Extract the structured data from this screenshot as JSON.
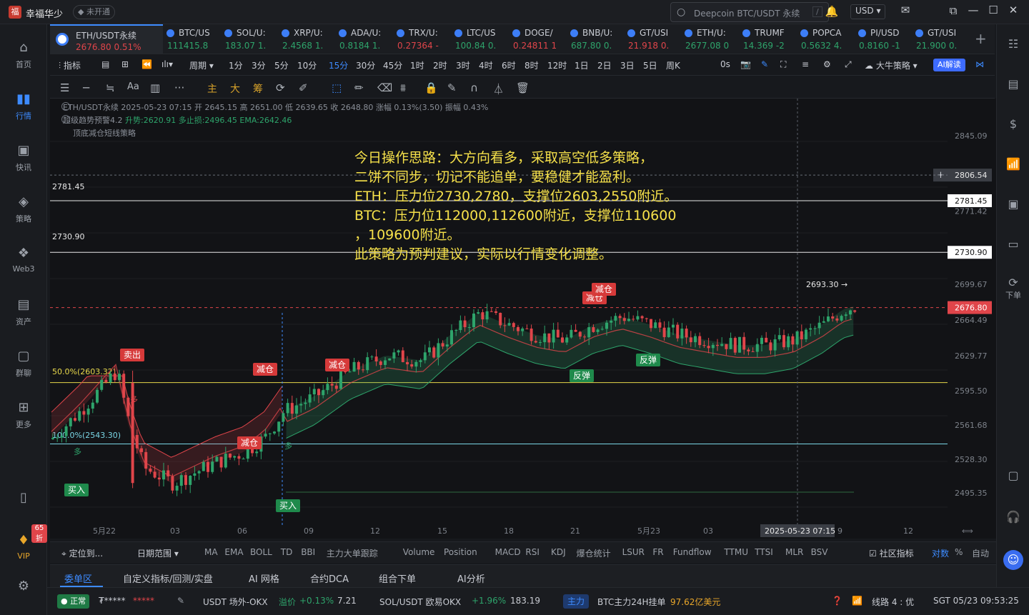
{
  "app": {
    "name": "幸福华少",
    "vip_status": "未开通"
  },
  "search": {
    "placeholder": "Deepcoin BTC/USDT 永续",
    "shortcut": "/"
  },
  "currency": "USD",
  "sidebar": [
    {
      "label": "首页",
      "icon": "home-icon"
    },
    {
      "label": "行情",
      "icon": "chart-bars-icon",
      "active": true
    },
    {
      "label": "快讯",
      "icon": "news-icon"
    },
    {
      "label": "策略",
      "icon": "strategy-icon"
    },
    {
      "label": "Web3",
      "icon": "web3-icon"
    },
    {
      "label": "资产",
      "icon": "wallet-icon"
    },
    {
      "label": "群聊",
      "icon": "chat-icon"
    },
    {
      "label": "更多",
      "icon": "grid-icon"
    }
  ],
  "vip_badge": "65折",
  "vip_label": "VIP",
  "tickers": [
    {
      "name": "ETH/USDT永续",
      "price": "2676.80",
      "change": "0.51%",
      "dir": "dn"
    },
    {
      "name": "BTC/US",
      "price": "111415.8",
      "change": "",
      "dir": "up"
    },
    {
      "name": "SOL/U:",
      "price": "183.07",
      "change": "1.",
      "dir": "up"
    },
    {
      "name": "XRP/U:",
      "price": "2.4568",
      "change": "1.",
      "dir": "up"
    },
    {
      "name": "ADA/U:",
      "price": "0.8184",
      "change": "1.",
      "dir": "up"
    },
    {
      "name": "TRX/U:",
      "price": "0.27364",
      "change": "-",
      "dir": "dn"
    },
    {
      "name": "LTC/US",
      "price": "100.84",
      "change": "0.",
      "dir": "up"
    },
    {
      "name": "DOGE/",
      "price": "0.24811",
      "change": "1",
      "dir": "dn"
    },
    {
      "name": "BNB/U:",
      "price": "687.80",
      "change": "0.",
      "dir": "up"
    },
    {
      "name": "GT/USI",
      "price": "21.918",
      "change": "0.",
      "dir": "dn"
    },
    {
      "name": "ETH/U:",
      "price": "2677.08",
      "change": "0",
      "dir": "up"
    },
    {
      "name": "TRUMF",
      "price": "14.369",
      "change": "-2",
      "dir": "up"
    },
    {
      "name": "POPCA",
      "price": "0.5632",
      "change": "4.",
      "dir": "up"
    },
    {
      "name": "PI/USD",
      "price": "0.8160",
      "change": "-1",
      "dir": "up"
    },
    {
      "name": "GT/USI",
      "price": "21.900",
      "change": "0.",
      "dir": "up"
    }
  ],
  "toolbar": {
    "indicator": "指标",
    "period_label": "周期",
    "periods": [
      "1分",
      "3分",
      "5分",
      "10分",
      "15分",
      "30分",
      "45分",
      "1时",
      "2时",
      "3时",
      "4时",
      "6时",
      "8时",
      "12时",
      "1日",
      "2日",
      "3日",
      "5日",
      "周K"
    ],
    "selected_period": "15分",
    "countdown": "0s",
    "strategy": "大牛策略",
    "ai": "AI解读"
  },
  "drawtools": {
    "main": "主",
    "big": "大",
    "chip": "筹",
    "font": "Aa"
  },
  "legend": {
    "line1": "ETH/USDT永续 2025-05-23 07:15 开 2645.15 高 2651.00 低 2639.65 收 2648.80 涨幅 0.13%(3.50) 振幅 0.43%",
    "line2a": "超级趋势预警4.2",
    "line2b": "升势:2620.91 多止损:2496.45 EMA:2642.46",
    "line3": "顶底减仓短线策略"
  },
  "annotation": [
    "今日操作思路：大方向看多，采取高空低多策略，",
    "二饼不同步，切记不能追单，要稳健才能盈利。",
    "ETH：压力位2730,2780，支撑位2603,2550附近。",
    "BTC：压力位112000,112600附近，支撑位110600",
    "，109600附近。",
    "此策略为预判建议，实际以行情变化调整。"
  ],
  "price_axis": [
    "2845.09",
    "2806.54",
    "2781.45",
    "2771.42",
    "2730.90",
    "2699.67",
    "2676.80",
    "2664.49",
    "2629.77",
    "2595.50",
    "2561.68",
    "2528.30",
    "2495.35"
  ],
  "time_axis": [
    "5月22",
    "03",
    "06",
    "09",
    "12",
    "15",
    "18",
    "21",
    "5月23",
    "03",
    "2025-05-23 07:15",
    "9",
    "12"
  ],
  "level_labels": {
    "l1": "2781.45",
    "l2": "2730.90",
    "fib50": "50.0%(2603.32)",
    "fib100": "100.0%(2543.30)",
    "high": "2693.30 →"
  },
  "signals": {
    "sell": "卖出",
    "reduce": "减仓",
    "buy": "买入",
    "rebound": "反弹",
    "many": "多"
  },
  "chart_colors": {
    "up": "#2ea46b",
    "down": "#e0454a",
    "yellow": "#e8d84a",
    "cyan": "#7ad6e6"
  },
  "indicator_bar": {
    "locate": "定位到...",
    "date_range": "日期范围",
    "items": [
      "MA",
      "EMA",
      "BOLL",
      "TD",
      "BBI",
      "主力大单跟踪",
      "Volume",
      "Position",
      "MACD",
      "RSI",
      "KDJ",
      "爆仓统计",
      "LSUR",
      "FR",
      "Fundflow",
      "TTMU",
      "TTSI",
      "MLR",
      "BSV"
    ],
    "community": "社区指标",
    "compare": "对数",
    "percent": "%",
    "auto": "自动"
  },
  "tabs": [
    "委单区",
    "自定义指标/回测/实盘",
    "AI 网格",
    "合约DCA",
    "组合下单",
    "AI分析"
  ],
  "status": {
    "normal": "正常",
    "account": "₮*****",
    "stars": "*****",
    "usdt": "USDT 场外-OKX",
    "premium_label": "溢价",
    "premium": "+0.13%",
    "usdt_price": "7.21",
    "sol": "SOL/USDT 欧易OKX",
    "sol_change": "+1.96%",
    "sol_price": "183.19",
    "main": "主力",
    "btc_main": "BTC主力24H挂单",
    "btc_main_val": "97.62亿美元",
    "line": "线路 4 : 优",
    "time": "SGT 05/23 09:53:25"
  },
  "right_panel": {
    "order": "下单"
  }
}
